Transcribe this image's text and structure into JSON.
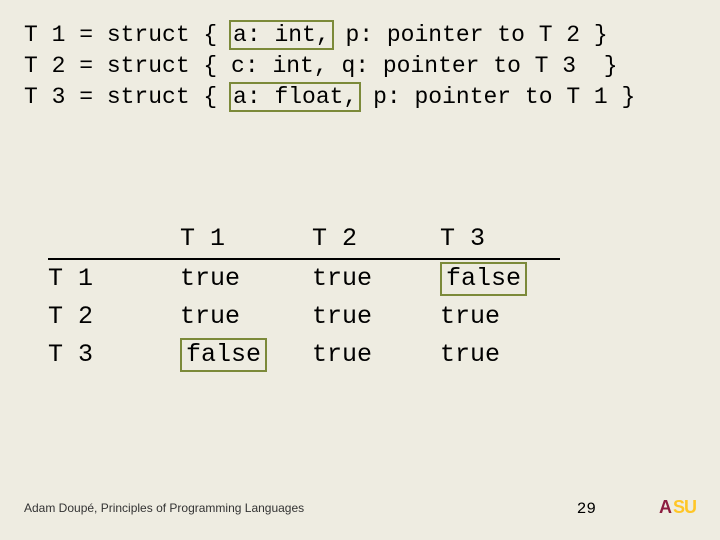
{
  "defs": {
    "t1_pre": "T 1 = struct { ",
    "t1_hl": "a: int,",
    "t1_post": " p: pointer to T 2 }",
    "t2_line": "T 2 = struct { c: int, q: pointer to T 3  }",
    "t3_pre": "T 3 = struct { ",
    "t3_hl": "a: float,",
    "t3_post": " p: pointer to T 1 }"
  },
  "table": {
    "headers": [
      "",
      "T 1",
      "T 2",
      "T 3"
    ],
    "rows": [
      {
        "label": "T 1",
        "cells": [
          {
            "v": "true",
            "box": false
          },
          {
            "v": "true",
            "box": false
          },
          {
            "v": "false",
            "box": true
          }
        ]
      },
      {
        "label": "T 2",
        "cells": [
          {
            "v": "true",
            "box": false
          },
          {
            "v": "true",
            "box": false
          },
          {
            "v": "true",
            "box": false
          }
        ]
      },
      {
        "label": "T 3",
        "cells": [
          {
            "v": "false",
            "box": true
          },
          {
            "v": "true",
            "box": false
          },
          {
            "v": "true",
            "box": false
          }
        ]
      }
    ]
  },
  "footer": {
    "credit": "Adam Doupé, Principles of Programming Languages",
    "page": "29",
    "logo_a": "A",
    "logo_s": "SU"
  }
}
